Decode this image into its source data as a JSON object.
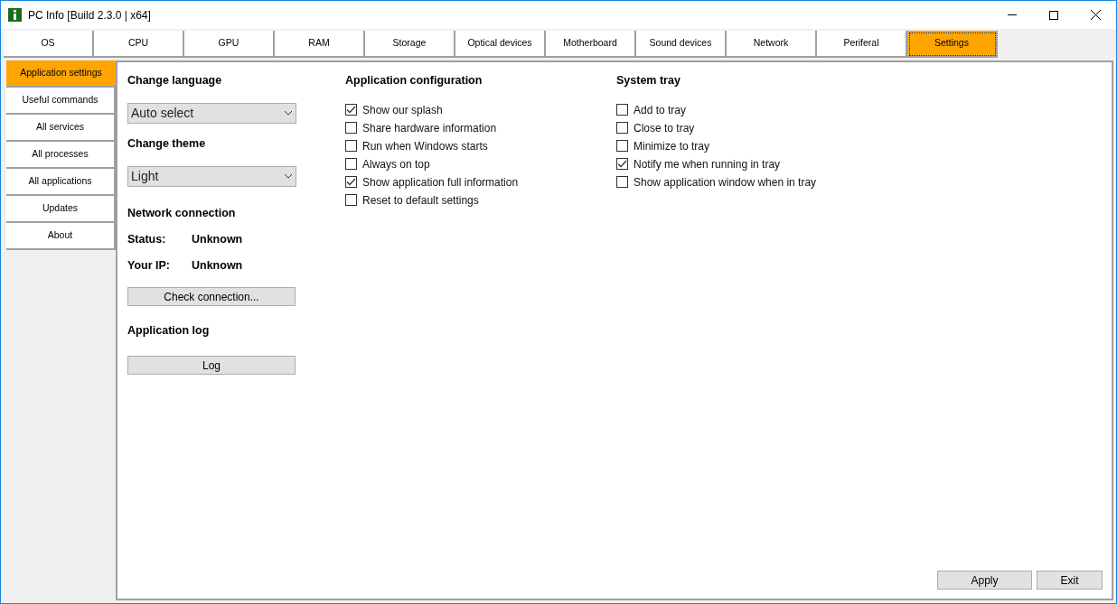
{
  "window": {
    "title": "PC Info [Build 2.3.0 | x64]"
  },
  "tabs": [
    {
      "label": "OS",
      "selected": false
    },
    {
      "label": "CPU",
      "selected": false
    },
    {
      "label": "GPU",
      "selected": false
    },
    {
      "label": "RAM",
      "selected": false
    },
    {
      "label": "Storage",
      "selected": false
    },
    {
      "label": "Optical devices",
      "selected": false
    },
    {
      "label": "Motherboard",
      "selected": false
    },
    {
      "label": "Sound devices",
      "selected": false
    },
    {
      "label": "Network",
      "selected": false
    },
    {
      "label": "Periferal",
      "selected": false
    },
    {
      "label": "Settings",
      "selected": true
    }
  ],
  "sidebar": {
    "items": [
      {
        "label": "Application settings",
        "selected": true
      },
      {
        "label": "Useful commands",
        "selected": false
      },
      {
        "label": "All services",
        "selected": false
      },
      {
        "label": "All processes",
        "selected": false
      },
      {
        "label": "All applications",
        "selected": false
      },
      {
        "label": "Updates",
        "selected": false
      },
      {
        "label": "About",
        "selected": false
      }
    ]
  },
  "language": {
    "heading": "Change language",
    "value": "Auto select"
  },
  "theme": {
    "heading": "Change theme",
    "value": "Light"
  },
  "network": {
    "heading": "Network connection",
    "rows": [
      {
        "label": "Status:",
        "value": "Unknown"
      },
      {
        "label": "Your IP:",
        "value": "Unknown"
      }
    ],
    "button": "Check connection..."
  },
  "log": {
    "heading": "Application log",
    "button": "Log"
  },
  "app_config": {
    "heading": "Application configuration",
    "options": [
      {
        "label": "Show our splash",
        "checked": true
      },
      {
        "label": "Share hardware information",
        "checked": false
      },
      {
        "label": "Run when Windows starts",
        "checked": false
      },
      {
        "label": "Always on top",
        "checked": false
      },
      {
        "label": "Show application full information",
        "checked": true
      },
      {
        "label": "Reset to default settings",
        "checked": false
      }
    ]
  },
  "system_tray": {
    "heading": "System tray",
    "options": [
      {
        "label": "Add to tray",
        "checked": false
      },
      {
        "label": "Close to tray",
        "checked": false
      },
      {
        "label": "Minimize to tray",
        "checked": false
      },
      {
        "label": "Notify me when running in tray",
        "checked": true
      },
      {
        "label": "Show application window when in tray",
        "checked": false
      }
    ]
  },
  "buttons": [
    "Apply",
    "Exit"
  ]
}
